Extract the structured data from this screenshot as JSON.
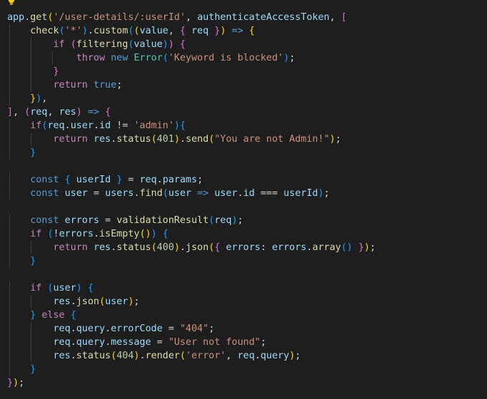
{
  "editor": {
    "lightbulb_icon": "lightbulb-icon",
    "language": "javascript",
    "lines": [
      [
        [
          "var",
          "app"
        ],
        [
          "pl",
          "."
        ],
        [
          "fn",
          "get"
        ],
        [
          "br1",
          "("
        ],
        [
          "str",
          "'/user-details/:userId'"
        ],
        [
          "pl",
          ", "
        ],
        [
          "var",
          "authenticateAccessToken"
        ],
        [
          "pl",
          ", "
        ],
        [
          "br2",
          "["
        ]
      ],
      [
        [
          "pl",
          "    "
        ],
        [
          "fn",
          "check"
        ],
        [
          "br3",
          "("
        ],
        [
          "str",
          "'*'"
        ],
        [
          "br3",
          ")"
        ],
        [
          "pl",
          "."
        ],
        [
          "fn",
          "custom"
        ],
        [
          "br3",
          "("
        ],
        [
          "br1",
          "("
        ],
        [
          "var",
          "value"
        ],
        [
          "pl",
          ", "
        ],
        [
          "br2",
          "{"
        ],
        [
          "pl",
          " "
        ],
        [
          "var",
          "req"
        ],
        [
          "pl",
          " "
        ],
        [
          "br2",
          "}"
        ],
        [
          "br1",
          ")"
        ],
        [
          "pl",
          " "
        ],
        [
          "kw",
          "=>"
        ],
        [
          "pl",
          " "
        ],
        [
          "br1",
          "{"
        ]
      ],
      [
        [
          "pl",
          "        "
        ],
        [
          "kw-ctrl",
          "if"
        ],
        [
          "pl",
          " "
        ],
        [
          "br2",
          "("
        ],
        [
          "fn",
          "filtering"
        ],
        [
          "br3",
          "("
        ],
        [
          "var",
          "value"
        ],
        [
          "br3",
          ")"
        ],
        [
          "br2",
          ")"
        ],
        [
          "pl",
          " "
        ],
        [
          "br2",
          "{"
        ]
      ],
      [
        [
          "pl",
          "            "
        ],
        [
          "kw-ctrl",
          "throw"
        ],
        [
          "pl",
          " "
        ],
        [
          "kw",
          "new"
        ],
        [
          "pl",
          " "
        ],
        [
          "cls",
          "Error"
        ],
        [
          "br3",
          "("
        ],
        [
          "str",
          "'Keyword is blocked'"
        ],
        [
          "br3",
          ")"
        ],
        [
          "pl",
          ";"
        ]
      ],
      [
        [
          "pl",
          "        "
        ],
        [
          "br2",
          "}"
        ]
      ],
      [
        [
          "pl",
          "        "
        ],
        [
          "kw-ctrl",
          "return"
        ],
        [
          "pl",
          " "
        ],
        [
          "kw",
          "true"
        ],
        [
          "pl",
          ";"
        ]
      ],
      [
        [
          "pl",
          "    "
        ],
        [
          "br1",
          "}"
        ],
        [
          "br3",
          ")"
        ],
        [
          "pl",
          ","
        ]
      ],
      [
        [
          "br2",
          "]"
        ],
        [
          "pl",
          ", "
        ],
        [
          "br2",
          "("
        ],
        [
          "var",
          "req"
        ],
        [
          "pl",
          ", "
        ],
        [
          "var",
          "res"
        ],
        [
          "br2",
          ")"
        ],
        [
          "pl",
          " "
        ],
        [
          "kw",
          "=>"
        ],
        [
          "pl",
          " "
        ],
        [
          "br2",
          "{"
        ]
      ],
      [
        [
          "pl",
          "    "
        ],
        [
          "kw-ctrl",
          "if"
        ],
        [
          "br3",
          "("
        ],
        [
          "var",
          "req"
        ],
        [
          "pl",
          "."
        ],
        [
          "var",
          "user"
        ],
        [
          "pl",
          "."
        ],
        [
          "var",
          "id"
        ],
        [
          "pl",
          " != "
        ],
        [
          "str",
          "'admin'"
        ],
        [
          "br3",
          ")"
        ],
        [
          "br3",
          "{"
        ]
      ],
      [
        [
          "pl",
          "        "
        ],
        [
          "kw-ctrl",
          "return"
        ],
        [
          "pl",
          " "
        ],
        [
          "var",
          "res"
        ],
        [
          "pl",
          "."
        ],
        [
          "fn",
          "status"
        ],
        [
          "br1",
          "("
        ],
        [
          "num",
          "401"
        ],
        [
          "br1",
          ")"
        ],
        [
          "pl",
          "."
        ],
        [
          "fn",
          "send"
        ],
        [
          "br1",
          "("
        ],
        [
          "str",
          "\"You are not Admin!\""
        ],
        [
          "br1",
          ")"
        ],
        [
          "pl",
          ";"
        ]
      ],
      [
        [
          "pl",
          "    "
        ],
        [
          "br3",
          "}"
        ]
      ],
      [],
      [
        [
          "pl",
          "    "
        ],
        [
          "kw",
          "const"
        ],
        [
          "pl",
          " "
        ],
        [
          "br3",
          "{"
        ],
        [
          "pl",
          " "
        ],
        [
          "var",
          "userId"
        ],
        [
          "pl",
          " "
        ],
        [
          "br3",
          "}"
        ],
        [
          "pl",
          " = "
        ],
        [
          "var",
          "req"
        ],
        [
          "pl",
          "."
        ],
        [
          "var",
          "params"
        ],
        [
          "pl",
          ";"
        ]
      ],
      [
        [
          "pl",
          "    "
        ],
        [
          "kw",
          "const"
        ],
        [
          "pl",
          " "
        ],
        [
          "var",
          "user"
        ],
        [
          "pl",
          " = "
        ],
        [
          "var",
          "users"
        ],
        [
          "pl",
          "."
        ],
        [
          "fn",
          "find"
        ],
        [
          "br3",
          "("
        ],
        [
          "var",
          "user"
        ],
        [
          "pl",
          " "
        ],
        [
          "kw",
          "=>"
        ],
        [
          "pl",
          " "
        ],
        [
          "var",
          "user"
        ],
        [
          "pl",
          "."
        ],
        [
          "var",
          "id"
        ],
        [
          "pl",
          " === "
        ],
        [
          "var",
          "userId"
        ],
        [
          "br3",
          ")"
        ],
        [
          "pl",
          ";"
        ]
      ],
      [],
      [
        [
          "pl",
          "    "
        ],
        [
          "kw",
          "const"
        ],
        [
          "pl",
          " "
        ],
        [
          "var",
          "errors"
        ],
        [
          "pl",
          " = "
        ],
        [
          "fn",
          "validationResult"
        ],
        [
          "br3",
          "("
        ],
        [
          "var",
          "req"
        ],
        [
          "br3",
          ")"
        ],
        [
          "pl",
          ";"
        ]
      ],
      [
        [
          "pl",
          "    "
        ],
        [
          "kw-ctrl",
          "if"
        ],
        [
          "pl",
          " "
        ],
        [
          "br3",
          "("
        ],
        [
          "pl",
          "!"
        ],
        [
          "var",
          "errors"
        ],
        [
          "pl",
          "."
        ],
        [
          "fn",
          "isEmpty"
        ],
        [
          "br1",
          "()"
        ],
        [
          "br3",
          ")"
        ],
        [
          "pl",
          " "
        ],
        [
          "br3",
          "{"
        ]
      ],
      [
        [
          "pl",
          "        "
        ],
        [
          "kw-ctrl",
          "return"
        ],
        [
          "pl",
          " "
        ],
        [
          "var",
          "res"
        ],
        [
          "pl",
          "."
        ],
        [
          "fn",
          "status"
        ],
        [
          "br1",
          "("
        ],
        [
          "num",
          "400"
        ],
        [
          "br1",
          ")"
        ],
        [
          "pl",
          "."
        ],
        [
          "fn",
          "json"
        ],
        [
          "br1",
          "("
        ],
        [
          "br2",
          "{"
        ],
        [
          "pl",
          " "
        ],
        [
          "var",
          "errors"
        ],
        [
          "pl",
          ": "
        ],
        [
          "var",
          "errors"
        ],
        [
          "pl",
          "."
        ],
        [
          "fn",
          "array"
        ],
        [
          "br3",
          "()"
        ],
        [
          "pl",
          " "
        ],
        [
          "br2",
          "}"
        ],
        [
          "br1",
          ")"
        ],
        [
          "pl",
          ";"
        ]
      ],
      [
        [
          "pl",
          "    "
        ],
        [
          "br3",
          "}"
        ]
      ],
      [],
      [
        [
          "pl",
          "    "
        ],
        [
          "kw-ctrl",
          "if"
        ],
        [
          "pl",
          " "
        ],
        [
          "br3",
          "("
        ],
        [
          "var",
          "user"
        ],
        [
          "br3",
          ")"
        ],
        [
          "pl",
          " "
        ],
        [
          "br3",
          "{"
        ]
      ],
      [
        [
          "pl",
          "        "
        ],
        [
          "var",
          "res"
        ],
        [
          "pl",
          "."
        ],
        [
          "fn",
          "json"
        ],
        [
          "br1",
          "("
        ],
        [
          "var",
          "user"
        ],
        [
          "br1",
          ")"
        ],
        [
          "pl",
          ";"
        ]
      ],
      [
        [
          "pl",
          "    "
        ],
        [
          "br3",
          "}"
        ],
        [
          "pl",
          " "
        ],
        [
          "kw-ctrl",
          "else"
        ],
        [
          "pl",
          " "
        ],
        [
          "br3",
          "{"
        ]
      ],
      [
        [
          "pl",
          "        "
        ],
        [
          "var",
          "req"
        ],
        [
          "pl",
          "."
        ],
        [
          "var",
          "query"
        ],
        [
          "pl",
          "."
        ],
        [
          "var",
          "errorCode"
        ],
        [
          "pl",
          " = "
        ],
        [
          "str",
          "\"404\""
        ],
        [
          "pl",
          ";"
        ]
      ],
      [
        [
          "pl",
          "        "
        ],
        [
          "var",
          "req"
        ],
        [
          "pl",
          "."
        ],
        [
          "var",
          "query"
        ],
        [
          "pl",
          "."
        ],
        [
          "var",
          "message"
        ],
        [
          "pl",
          " = "
        ],
        [
          "str",
          "\"User not found\""
        ],
        [
          "pl",
          ";"
        ]
      ],
      [
        [
          "pl",
          "        "
        ],
        [
          "var",
          "res"
        ],
        [
          "pl",
          "."
        ],
        [
          "fn",
          "status"
        ],
        [
          "br1",
          "("
        ],
        [
          "num",
          "404"
        ],
        [
          "br1",
          ")"
        ],
        [
          "pl",
          "."
        ],
        [
          "fn",
          "render"
        ],
        [
          "br1",
          "("
        ],
        [
          "str",
          "'error'"
        ],
        [
          "pl",
          ", "
        ],
        [
          "var",
          "req"
        ],
        [
          "pl",
          "."
        ],
        [
          "var",
          "query"
        ],
        [
          "br1",
          ")"
        ],
        [
          "pl",
          ";"
        ]
      ],
      [
        [
          "pl",
          "    "
        ],
        [
          "br3",
          "}"
        ]
      ],
      [
        [
          "br2",
          "}"
        ],
        [
          "br1",
          ")"
        ],
        [
          "pl",
          ";"
        ]
      ]
    ]
  }
}
